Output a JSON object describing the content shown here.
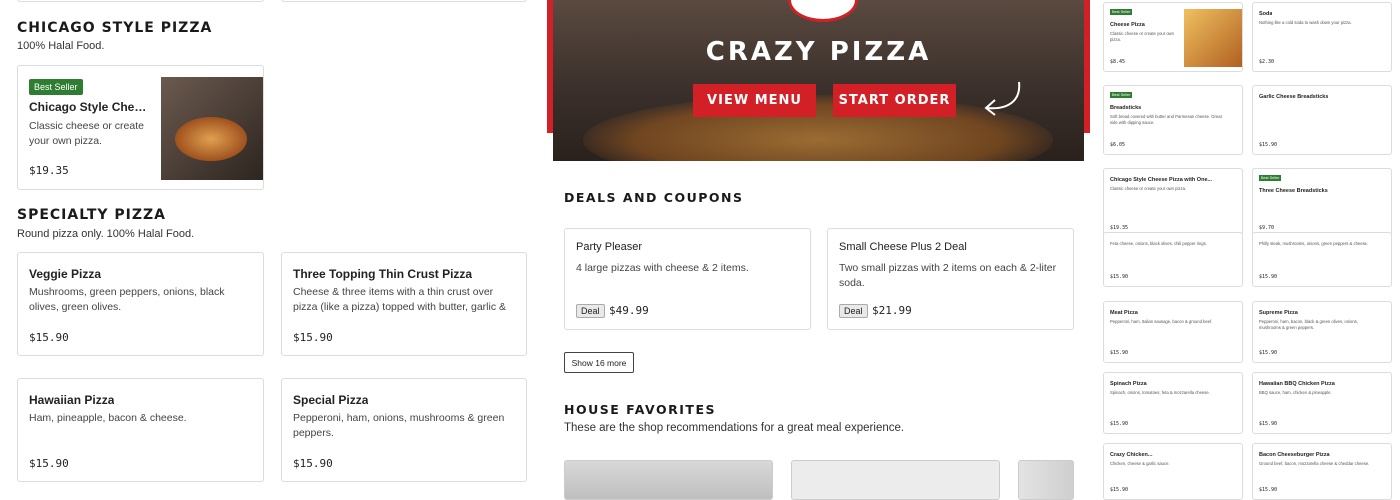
{
  "left": {
    "chicago": {
      "title": "CHICAGO STYLE PIZZA",
      "subtitle": "100% Halal Food.",
      "card": {
        "badge": "Best Seller",
        "name": "Chicago Style Cheese...",
        "desc": "Classic cheese or create your own pizza.",
        "price": "$19.35"
      }
    },
    "specialty": {
      "title": "SPECIALTY PIZZA",
      "subtitle": "Round pizza only. 100% Halal Food.",
      "items": [
        {
          "name": "Veggie Pizza",
          "desc": "Mushrooms, green peppers, onions, black olives, green olives.",
          "price": "$15.90"
        },
        {
          "name": "Three Topping Thin Crust Pizza",
          "desc": "Cheese & three items with a thin crust over pizza (like a pizza) topped with butter, garlic & parmes...",
          "price": "$15.90"
        },
        {
          "name": "Hawaiian Pizza",
          "desc": "Ham, pineapple, bacon & cheese.",
          "price": "$15.90"
        },
        {
          "name": "Special Pizza",
          "desc": "Pepperoni, ham, onions, mushrooms & green peppers.",
          "price": "$15.90"
        }
      ]
    }
  },
  "hero": {
    "title": "CRAZY PIZZA",
    "view_menu": "VIEW MENU",
    "start_order": "START ORDER"
  },
  "deals": {
    "title": "DEALS AND COUPONS",
    "items": [
      {
        "name": "Party Pleaser",
        "desc": "4 large pizzas with cheese & 2 items.",
        "tag": "Deal",
        "price": "$49.99"
      },
      {
        "name": "Small Cheese Plus 2 Deal",
        "desc": "Two small pizzas with 2 items on each & 2-liter soda.",
        "tag": "Deal",
        "price": "$21.99"
      }
    ],
    "more": "Show 16 more"
  },
  "favorites": {
    "title": "HOUSE FAVORITES",
    "subtitle": "These are the shop recommendations for a great meal experience."
  },
  "right": {
    "col1": [
      {
        "badge": "Best Seller",
        "name": "Cheese Pizza",
        "desc": "Classic cheese or create your own pizza.",
        "price": "$8.45"
      },
      {
        "badge": "Best Seller",
        "name": "Breadsticks",
        "desc": "Soft bread covered with butter and Parmesan cheese. Great side with dipping sauce.",
        "price": "$6.05"
      },
      {
        "badge": "",
        "name": "Chicago Style Cheese Pizza with One...",
        "desc": "Classic cheese or create your own pizza.",
        "price": "$19.35"
      },
      {
        "badge": "",
        "name": "",
        "desc": "Feta cheese, onions, black olives, chili pepper rings.",
        "price": "$15.90"
      },
      {
        "badge": "",
        "name": "Meat Pizza",
        "desc": "Pepperoni, ham, Italian sausage, bacon & ground beef.",
        "price": "$15.90"
      },
      {
        "badge": "",
        "name": "Spinach Pizza",
        "desc": "Spinach, onions, tomatoes, feta & mozzarella cheese.",
        "price": "$15.90"
      },
      {
        "badge": "",
        "name": "Crazy Chicken...",
        "desc": "Chicken, cheese & garlic sauce.",
        "price": "$15.90"
      }
    ],
    "col2": [
      {
        "badge": "",
        "name": "Soda",
        "desc": "Nothing like a cold soda to wash down your pizza.",
        "price": "$2.30"
      },
      {
        "badge": "",
        "name": "Garlic Cheese Breadsticks",
        "desc": "",
        "price": "$15.90"
      },
      {
        "badge": "Best Seller",
        "name": "Three Cheese Breadsticks",
        "desc": "",
        "price": "$9.70"
      },
      {
        "badge": "",
        "name": "",
        "desc": "Philly steak, mushrooms, onions, green peppers & cheese.",
        "price": "$15.90"
      },
      {
        "badge": "",
        "name": "Supreme Pizza",
        "desc": "Pepperoni, ham, bacon, black & green olives, onions, mushrooms & green peppers.",
        "price": "$15.90"
      },
      {
        "badge": "",
        "name": "Hawaiian BBQ Chicken Pizza",
        "desc": "BBQ sauce, ham, chicken & pineapple.",
        "price": "$15.90"
      },
      {
        "badge": "",
        "name": "Bacon Cheeseburger Pizza",
        "desc": "Ground beef, bacon, mozzarella cheese & cheddar cheese.",
        "price": "$15.90"
      }
    ]
  }
}
